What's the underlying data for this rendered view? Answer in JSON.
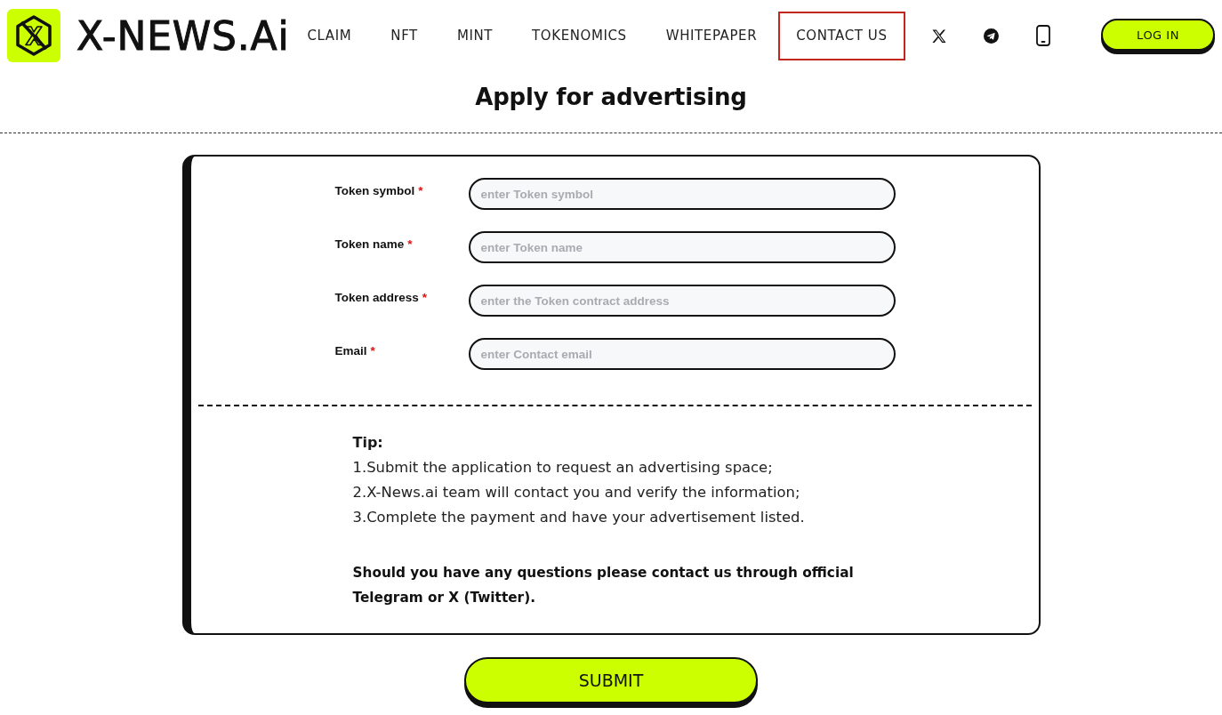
{
  "header": {
    "logo_text": "X-NEWS.Ai",
    "nav": [
      {
        "label": "CLAIM",
        "selected": false
      },
      {
        "label": "NFT",
        "selected": false
      },
      {
        "label": "MINT",
        "selected": false
      },
      {
        "label": "TOKENOMICS",
        "selected": false
      },
      {
        "label": "WHITEPAPER",
        "selected": false
      },
      {
        "label": "CONTACT US",
        "selected": true
      }
    ],
    "social": [
      {
        "kind": "x"
      },
      {
        "kind": "telegram"
      },
      {
        "kind": "phone"
      }
    ],
    "login_button": "LOG IN"
  },
  "page_title": "Apply for advertising",
  "form": {
    "fields": [
      {
        "label": "Token symbol",
        "mark": "*",
        "placeholder": "enter Token symbol"
      },
      {
        "label": "Token name",
        "mark": "*",
        "placeholder": "enter Token name"
      },
      {
        "label": "Token address",
        "mark": "*",
        "placeholder": "enter the Token contract address"
      },
      {
        "label": "Email",
        "mark": "*",
        "placeholder": "enter Contact email"
      }
    ]
  },
  "tips": {
    "heading": "Tip:",
    "lines": [
      "1.Submit the application to request an advertising space;",
      "2.X-News.ai team will contact you and verify the information;",
      "3.Complete the payment and have your advertisement listed."
    ],
    "note": "Should you have any questions please contact us through official Telegram or X (Twitter)."
  },
  "submit_button": "SUBMIT"
}
